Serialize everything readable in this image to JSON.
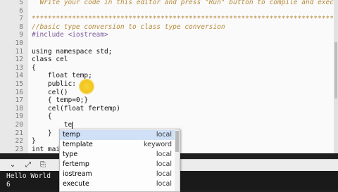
{
  "editor": {
    "lines": [
      {
        "num": "5",
        "text": "  Write your code in this editor and press \"Run\" button to compile and execute it.",
        "style": "comment"
      },
      {
        "num": "6",
        "text": "",
        "style": "plain"
      },
      {
        "num": "7",
        "text": "*******************************************************************************",
        "style": "comment"
      },
      {
        "num": "8",
        "text": "//basic type conversion to class type conversion",
        "style": "comment"
      },
      {
        "num": "9",
        "text": "#include <iostream>",
        "style": "pre"
      },
      {
        "num": "10",
        "text": "",
        "style": "plain"
      },
      {
        "num": "11",
        "text": "using namespace std;",
        "style": "kw"
      },
      {
        "num": "12",
        "text": "class cel",
        "style": "plain"
      },
      {
        "num": "13",
        "text": "{",
        "style": "plain"
      },
      {
        "num": "14",
        "text": "    float temp;",
        "style": "plain"
      },
      {
        "num": "15",
        "text": "    public:",
        "style": "plain"
      },
      {
        "num": "16",
        "text": "    cel()",
        "style": "plain"
      },
      {
        "num": "17",
        "text": "    { temp=0;}",
        "style": "plain"
      },
      {
        "num": "18",
        "text": "    cel(float fertemp)",
        "style": "plain"
      },
      {
        "num": "19",
        "text": "    {",
        "style": "plain"
      },
      {
        "num": "20",
        "text": "        te",
        "style": "plain",
        "cursor": true
      },
      {
        "num": "21",
        "text": "    }",
        "style": "plain"
      },
      {
        "num": "22",
        "text": "}",
        "style": "plain"
      },
      {
        "num": "23",
        "text": "int main",
        "style": "plain"
      }
    ]
  },
  "autocomplete": {
    "items": [
      {
        "name": "temp",
        "kind": "local",
        "selected": true
      },
      {
        "name": "template",
        "kind": "keyword",
        "selected": false
      },
      {
        "name": "type",
        "kind": "local",
        "selected": false
      },
      {
        "name": "fertemp",
        "kind": "local",
        "selected": false
      },
      {
        "name": "iostream",
        "kind": "local",
        "selected": false
      },
      {
        "name": "execute",
        "kind": "local",
        "selected": false
      }
    ]
  },
  "toolbar": {
    "icons": [
      "collapse-icon",
      "expand-icon",
      "clear-output-icon"
    ]
  },
  "output": {
    "lines": [
      "Hello World",
      "6"
    ]
  }
}
